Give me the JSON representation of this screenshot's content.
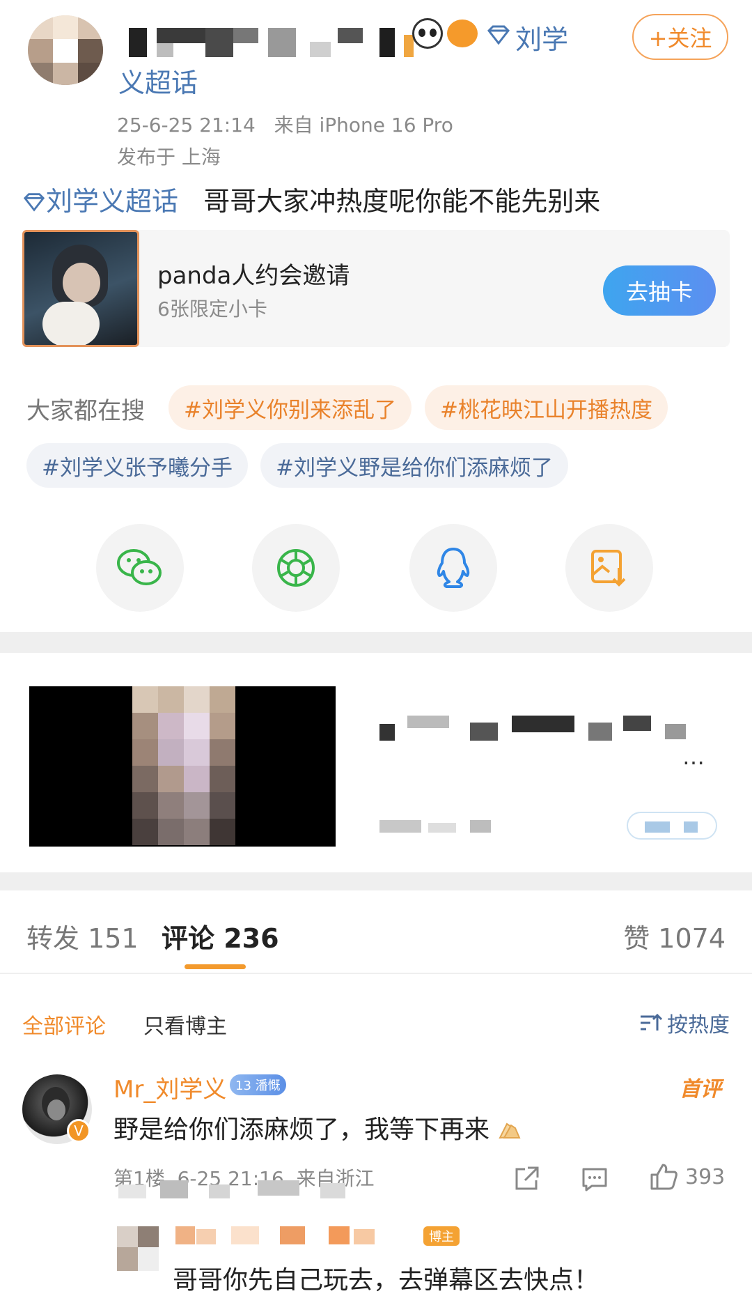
{
  "post": {
    "name_tail": "刘学",
    "name_line2": "义超话",
    "follow_label": "+关注",
    "meta_time_device": "25-6-25 21:14   来自 iPhone 16 Pro",
    "meta_location": "发布于 上海",
    "topic": "刘学义超话",
    "text": "哥哥大家冲热度呢你能不能先别来"
  },
  "card": {
    "title": "panda人约会邀请",
    "subtitle": "6张限定小卡",
    "button": "去抽卡"
  },
  "search": {
    "label": "大家都在搜",
    "tags": [
      "#刘学义你别来添乱了",
      "#桃花映江山开播热度",
      "#刘学义张予曦分手",
      "#刘学义野是给你们添麻烦了"
    ]
  },
  "share_icons": [
    "wechat-icon",
    "moments-icon",
    "qq-icon",
    "save-image-icon"
  ],
  "recommend": {
    "visible_fragment": "…"
  },
  "tabs": {
    "repost": "转发 151",
    "comment": "评论 236",
    "like": "赞 1074"
  },
  "filter": {
    "all": "全部评论",
    "owner_only": "只看博主",
    "sort": "按热度"
  },
  "comment": {
    "author": "Mr_刘学义",
    "level_badge": "13 潘慨",
    "first_badge": "首评",
    "text": "野是给你们添麻烦了，我等下再来",
    "meta": "第1楼  6-25 21:16  来自浙江",
    "likes": "393"
  },
  "reply": {
    "badge": "博主",
    "text": "哥哥你先自己玩去，去弹幕区去快点！"
  },
  "colors": {
    "accent_orange": "#f39a2d",
    "link_blue": "#4a78b3",
    "button_blue": "#3ea5ef"
  }
}
